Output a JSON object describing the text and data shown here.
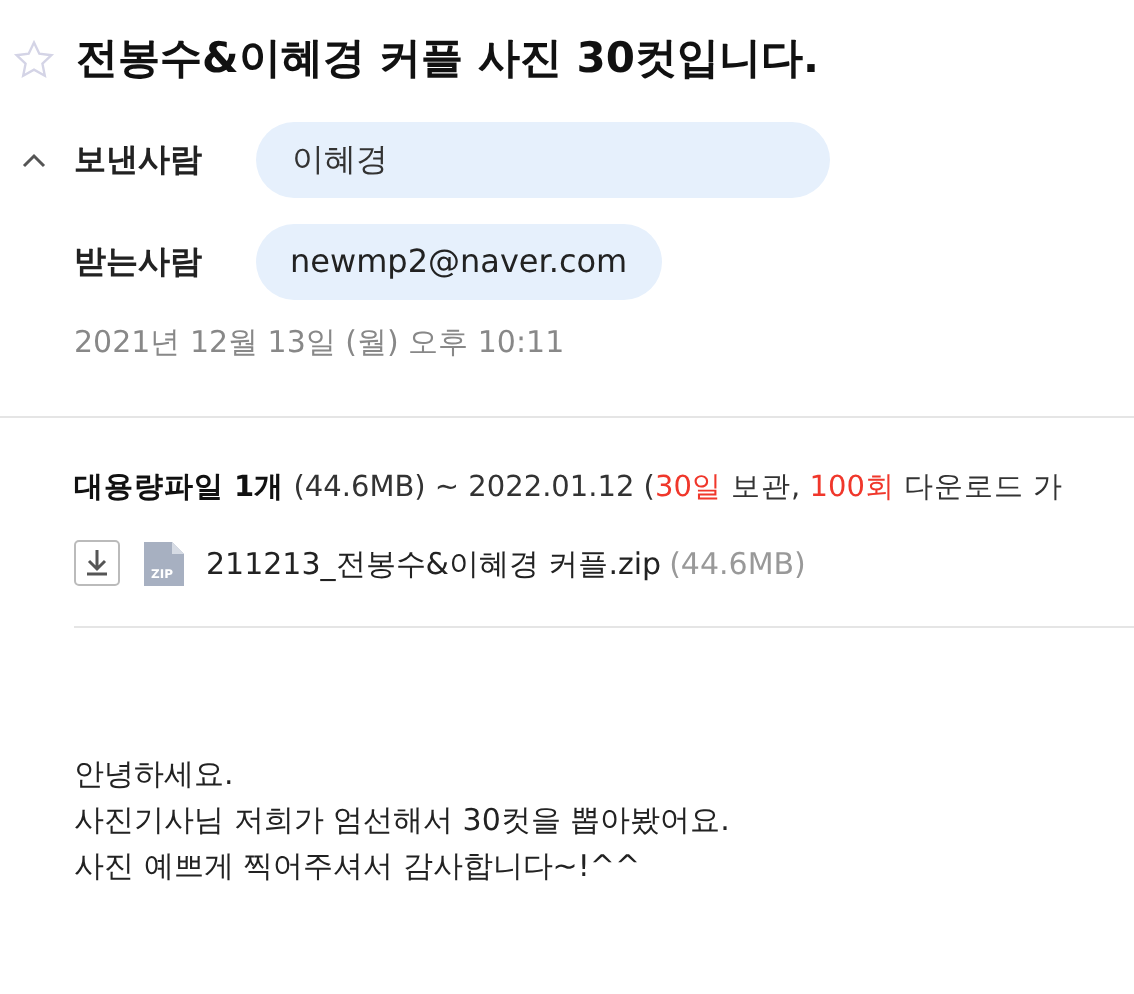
{
  "subject": {
    "starred": false,
    "title": "전봉수&이혜경 커플 사진 30컷입니다."
  },
  "header": {
    "expanded": true,
    "sender": {
      "label": "보낸사람",
      "name": "이혜경"
    },
    "recipient": {
      "label": "받는사람",
      "address": "newmp2@naver.com"
    },
    "date": "2021년 12월 13일 (월) 오후 10:11"
  },
  "attachments": {
    "summary": [
      {
        "kind": "bold",
        "text": "대용량파일 1개"
      },
      {
        "kind": "plain",
        "text": " (44.6MB) ~ 2022.01.12 ("
      },
      {
        "kind": "red",
        "text": "30일"
      },
      {
        "kind": "plain",
        "text": " 보관, "
      },
      {
        "kind": "red",
        "text": "100회"
      },
      {
        "kind": "plain",
        "text": " 다운로드 가"
      }
    ],
    "files": [
      {
        "file_type": "ZIP",
        "name": "211213_전봉수&이혜경 커플.zip",
        "size": "(44.6MB)"
      }
    ]
  },
  "body": [
    "안녕하세요.",
    "사진기사님 저희가 엄선해서 30컷을 뽑아봤어요.",
    "사진 예쁘게 찍어주셔서 감사합니다~!^^"
  ]
}
